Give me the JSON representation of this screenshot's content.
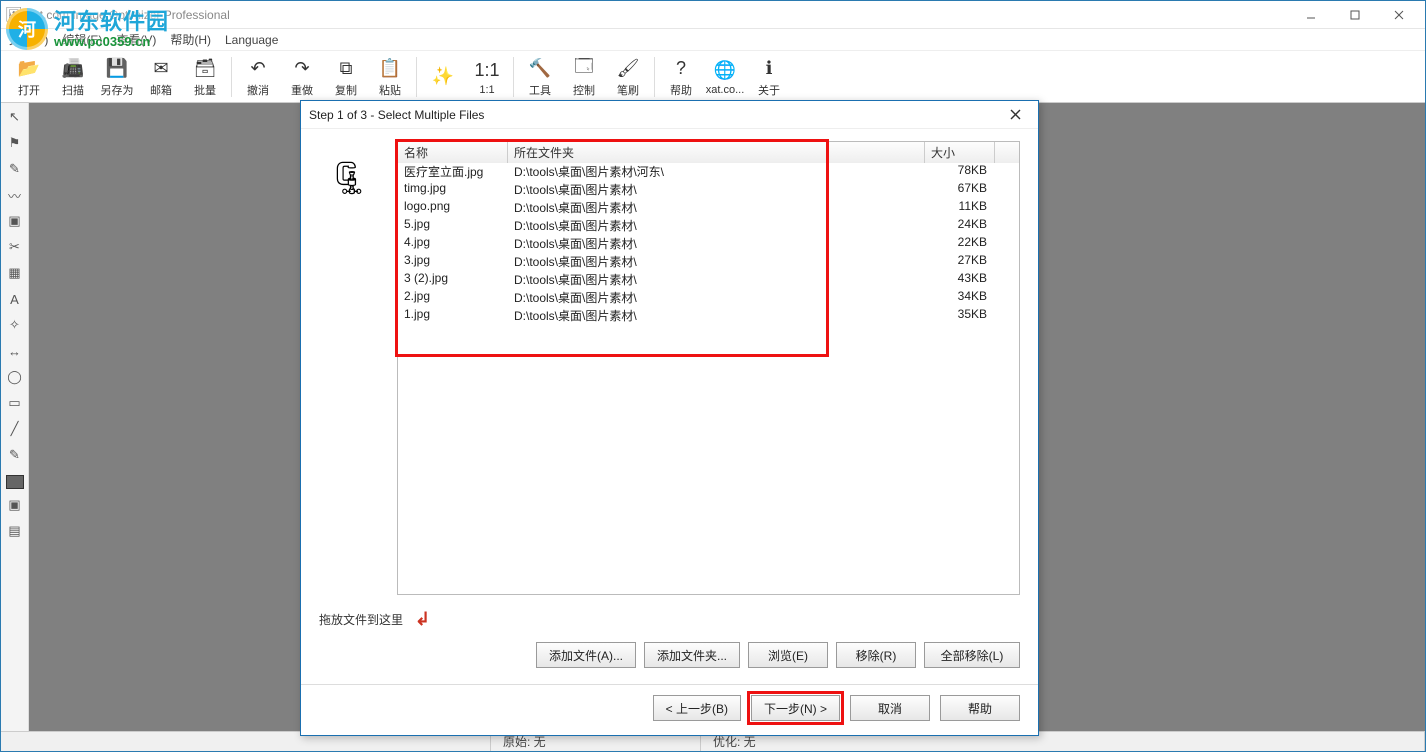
{
  "watermark": {
    "cn": "河东软件园",
    "url": "www.pc0359.cn"
  },
  "titlebar": {
    "app_icon": "image-icon",
    "title": "xat.com  Image Optimizer Professional"
  },
  "menubar": {
    "items": [
      {
        "label": "文件(F)"
      },
      {
        "label": "编辑(E)"
      },
      {
        "label": "查看(V)"
      },
      {
        "label": "帮助(H)"
      },
      {
        "label": "Language"
      }
    ]
  },
  "toolbar": {
    "groups": [
      [
        {
          "label": "打开",
          "icon": "folder-open-icon",
          "glyph": "📂"
        },
        {
          "label": "扫描",
          "icon": "scanner-icon",
          "glyph": "📠"
        },
        {
          "label": "另存为",
          "icon": "save-icon",
          "glyph": "💾"
        },
        {
          "label": "邮箱",
          "icon": "mail-icon",
          "glyph": "✉"
        },
        {
          "label": "批量",
          "icon": "batch-icon",
          "glyph": "🗃"
        }
      ],
      [
        {
          "label": "撤消",
          "icon": "undo-icon",
          "glyph": "↶"
        },
        {
          "label": "重做",
          "icon": "redo-icon",
          "glyph": "↷"
        },
        {
          "label": "复制",
          "icon": "copy-icon",
          "glyph": "⧉"
        },
        {
          "label": "粘贴",
          "icon": "paste-icon",
          "glyph": "📋"
        }
      ],
      [
        {
          "label": "",
          "icon": "wand-icon",
          "glyph": "✨"
        },
        {
          "label": "1:1",
          "icon": "zoom-actual-icon",
          "glyph": "1:1"
        }
      ],
      [
        {
          "label": "工具",
          "icon": "tools-icon",
          "glyph": "🔨"
        },
        {
          "label": "控制",
          "icon": "control-icon",
          "glyph": "🗔"
        },
        {
          "label": "笔刷",
          "icon": "brush-icon",
          "glyph": "🖌"
        }
      ],
      [
        {
          "label": "帮助",
          "icon": "help-icon",
          "glyph": "?"
        },
        {
          "label": "xat.co...",
          "icon": "globe-icon",
          "glyph": "🌐"
        },
        {
          "label": "关于",
          "icon": "info-icon",
          "glyph": "ℹ"
        }
      ]
    ]
  },
  "tool_strip": {
    "tools": [
      {
        "name": "pointer-tool-icon",
        "glyph": "↖"
      },
      {
        "name": "flag-tool-icon",
        "glyph": "⚑"
      },
      {
        "name": "brush-tool-icon",
        "glyph": "✎"
      },
      {
        "name": "lasso-tool-icon",
        "glyph": "〰"
      },
      {
        "name": "image-tool-icon",
        "glyph": "▣"
      },
      {
        "name": "crop-tool-icon",
        "glyph": "✂"
      },
      {
        "name": "bucket-tool-icon",
        "glyph": "▦"
      },
      {
        "name": "text-tool-icon",
        "glyph": "A"
      },
      {
        "name": "magic-wand-tool-icon",
        "glyph": "✧"
      },
      {
        "name": "move-tool-icon",
        "glyph": "↔"
      },
      {
        "name": "ellipse-tool-icon",
        "glyph": "◯"
      },
      {
        "name": "rect-tool-icon",
        "glyph": "▭"
      },
      {
        "name": "line-tool-icon",
        "glyph": "╱"
      },
      {
        "name": "eyedropper-tool-icon",
        "glyph": "✎"
      }
    ]
  },
  "statusbar": {
    "left": "原始: 无",
    "right": "优化: 无"
  },
  "dialog": {
    "title": "Step 1 of 3 - Select Multiple Files",
    "wizard_icon": "compress-wizard-icon",
    "columns": {
      "name": "名称",
      "folder": "所在文件夹",
      "size": "大小"
    },
    "rows": [
      {
        "name": "医疗室立面.jpg",
        "folder": "D:\\tools\\桌面\\图片素材\\河东\\",
        "size": "78KB"
      },
      {
        "name": "timg.jpg",
        "folder": "D:\\tools\\桌面\\图片素材\\",
        "size": "67KB"
      },
      {
        "name": "logo.png",
        "folder": "D:\\tools\\桌面\\图片素材\\",
        "size": "11KB"
      },
      {
        "name": "5.jpg",
        "folder": "D:\\tools\\桌面\\图片素材\\",
        "size": "24KB"
      },
      {
        "name": "4.jpg",
        "folder": "D:\\tools\\桌面\\图片素材\\",
        "size": "22KB"
      },
      {
        "name": "3.jpg",
        "folder": "D:\\tools\\桌面\\图片素材\\",
        "size": "27KB"
      },
      {
        "name": "3 (2).jpg",
        "folder": "D:\\tools\\桌面\\图片素材\\",
        "size": "43KB"
      },
      {
        "name": "2.jpg",
        "folder": "D:\\tools\\桌面\\图片素材\\",
        "size": "34KB"
      },
      {
        "name": "1.jpg",
        "folder": "D:\\tools\\桌面\\图片素材\\",
        "size": "35KB"
      }
    ],
    "drop_hint": "拖放文件到这里",
    "buttons": {
      "add_file": "添加文件(A)...",
      "add_folder": "添加文件夹...",
      "browse": "浏览(E)",
      "remove": "移除(R)",
      "remove_all": "全部移除(L)",
      "back": "< 上一步(B)",
      "next": "下一步(N) >",
      "cancel": "取消",
      "help": "帮助"
    }
  }
}
